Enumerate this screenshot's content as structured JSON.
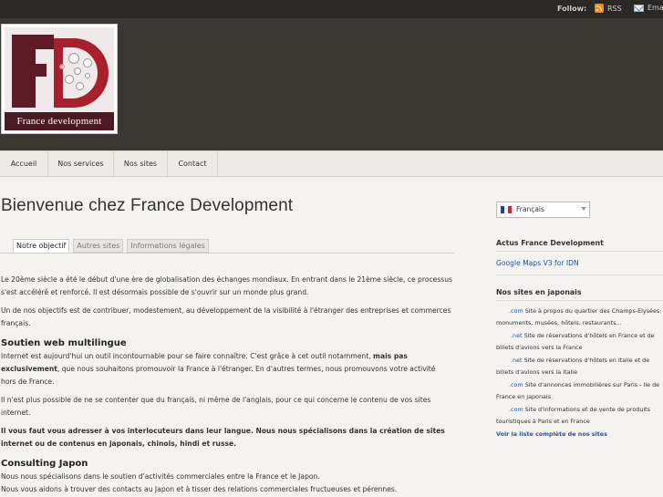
{
  "topbar": {
    "follow_label": "Follow:",
    "rss_label": "RSS",
    "email_label": "Email"
  },
  "logo": {
    "text": "France development"
  },
  "nav": {
    "items": [
      "Accueil",
      "Nos services",
      "Nos sites",
      "Contact"
    ]
  },
  "main": {
    "title": "Bienvenue chez France Development",
    "tabs": [
      "Notre objectif",
      "Autres sites",
      "Informations légales"
    ],
    "paragraphs": {
      "p1": "Le 20ème siècle a été le début d'une ère de globalisation des échanges mondiaux. En entrant dans le 21ème siècle, ce processus s'est accéléré et renforcé. Il est désormais possible de s'ouvrir sur un monde plus grand.",
      "p2": "Un de nos objectifs est de contribuer, modestement, au développement de la visibilité à l'étranger des entreprises et commerces français.",
      "h_multilingue": "Soutien web multilingue",
      "p3_a": "Internet est aujourd'hui un outil incontournable pour se faire connaître. C'est grâce à cet outil notamment, ",
      "p3_bold": "mais pas exclusivement",
      "p3_b": ", que nous souhaitons promouvoir la France à l'étranger. En d'autres termes, nous promouvons votre activité hors de France.",
      "p4": "Il n'est plus possible de ne se contenter que du français, ni même de l'anglais, pour ce qui concerne le contenu de vos sites internet.",
      "p5": "Il vous faut vous adresser à vos interlocuteurs dans leur langue. Nous nous spécialisons dans la création de sites internet ou de contenus en japonais, chinois, hindi et russe.",
      "h_consulting": "Consulting Japon",
      "p6": "Nous nous spécialisons dans le soutien d'activités commerciales entre la France et le Japon.",
      "p7": "Nous vous aidons à trouver des contacts au Japon et à tisser des relations commerciales fructueuses et pérennes."
    }
  },
  "sidebar": {
    "language": "Français",
    "actus_heading": "Actus France Development",
    "actus_link": "Google Maps V3 for IDN",
    "sites_heading": "Nos sites en japonais",
    "sites": [
      {
        "tld": ".com",
        "desc": "Site à propos du quartier des Champs-Elysées: monuments, musées, hôtels, restaurants..."
      },
      {
        "tld": ".net",
        "desc": "Site de réservations d'hôtels en France et de billets d'avions vers la France"
      },
      {
        "tld": ".net",
        "desc": "Site de réservations d'hôtels en Italie et de billets d'avions vers la Italie"
      },
      {
        "tld": ".com",
        "desc": "Site d'annonces immobilières sur Paris - Ile de France en japonais"
      },
      {
        "tld": ".com",
        "desc": "Site d'informations et de vente de produits touristiques à Paris et en France"
      }
    ],
    "all_sites_link": "Voir la liste complète de nos sites"
  },
  "colors": {
    "header_bg": "#3b3733",
    "topbar_bg": "#2b2926",
    "link": "#2855a0",
    "logo_red": "#a8202e",
    "logo_dark": "#5e1b26"
  }
}
